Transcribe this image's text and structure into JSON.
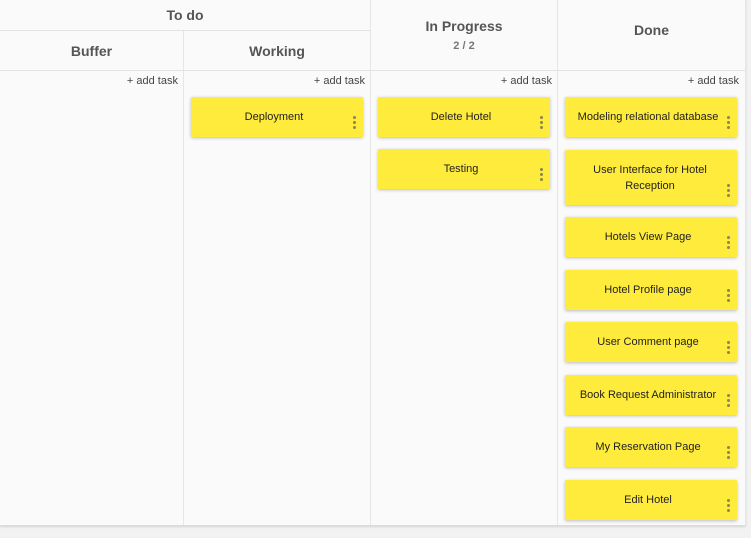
{
  "board": {
    "group_title": "To do",
    "columns": {
      "buffer": {
        "title": "Buffer",
        "add_task": "+ add task",
        "cards": []
      },
      "working": {
        "title": "Working",
        "add_task": "+ add task",
        "cards": [
          "Deployment"
        ]
      },
      "in_progress": {
        "title": "In Progress",
        "wip": "2 / 2",
        "add_task": "+ add task",
        "cards": [
          "Delete Hotel",
          "Testing"
        ]
      },
      "done": {
        "title": "Done",
        "add_task": "+ add task",
        "cards": [
          "Modeling relational database",
          "User Interface for Hotel Reception",
          "Hotels View Page",
          "Hotel Profile page",
          "User Comment page",
          "Book Request Administrator",
          "My Reservation Page",
          "Edit Hotel"
        ]
      }
    }
  },
  "colors": {
    "card": "#ffeb3b",
    "board_bg": "#fafafa",
    "text": "#555555"
  },
  "icons": {
    "card_menu": "kebab-menu-icon"
  }
}
